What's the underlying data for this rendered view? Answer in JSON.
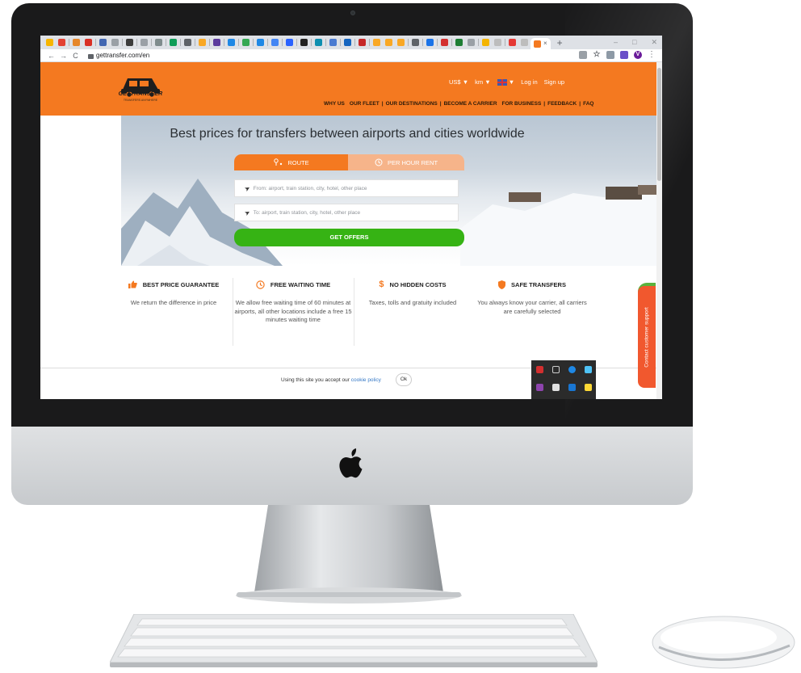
{
  "browser": {
    "url": "gettransfer.com/en",
    "new_tab": "+",
    "active_tab_close": "×",
    "window_controls": [
      "–",
      "□",
      "✕"
    ],
    "nav": {
      "back": "←",
      "forward": "→",
      "reload": "C"
    },
    "menu": "⋮",
    "profile_initial": "V"
  },
  "site": {
    "logo": {
      "name": "GETTRANSFER",
      "tagline": "TRANSFERS ANYWHERE"
    },
    "header_top": {
      "currency": "US$",
      "units": "km",
      "login": "Log in",
      "signup": "Sign up",
      "caret": "▼"
    },
    "nav": [
      "WHY US",
      "OUR FLEET",
      "OUR DESTINATIONS",
      "BECOME A CARRIER",
      "FOR BUSINESS",
      "FEEDBACK",
      "FAQ"
    ],
    "nav_separator": "|",
    "hero": {
      "title": "Best prices for transfers between airports and cities worldwide",
      "tab_route": "ROUTE",
      "tab_hour": "PER HOUR RENT",
      "from_placeholder": "From: airport, train station, city, hotel, other place",
      "to_placeholder": "To: airport, train station, city, hotel, other place",
      "submit": "GET OFFERS"
    },
    "features": [
      {
        "title": "BEST PRICE GUARANTEE",
        "desc": "We return the difference in price",
        "icon": "thumbs-up-icon"
      },
      {
        "title": "FREE WAITING TIME",
        "desc": "We allow free waiting time of 60 minutes at airports, all other locations include a free 15 minutes waiting time",
        "icon": "clock-icon"
      },
      {
        "title": "NO HIDDEN COSTS",
        "desc": "Taxes, tolls and gratuity included",
        "icon": "dollar-icon"
      },
      {
        "title": "SAFE TRANSFERS",
        "desc": "You always know your carrier, all carriers are carefully selected",
        "icon": "shield-icon"
      }
    ],
    "cookie": {
      "text": "Using this site you accept our",
      "link": "cookie policy",
      "ok": "Ok"
    },
    "support": "Contact customer support"
  },
  "colors": {
    "brand_orange": "#f47920",
    "cta_green": "#36b314",
    "support_red": "#f1582e"
  }
}
